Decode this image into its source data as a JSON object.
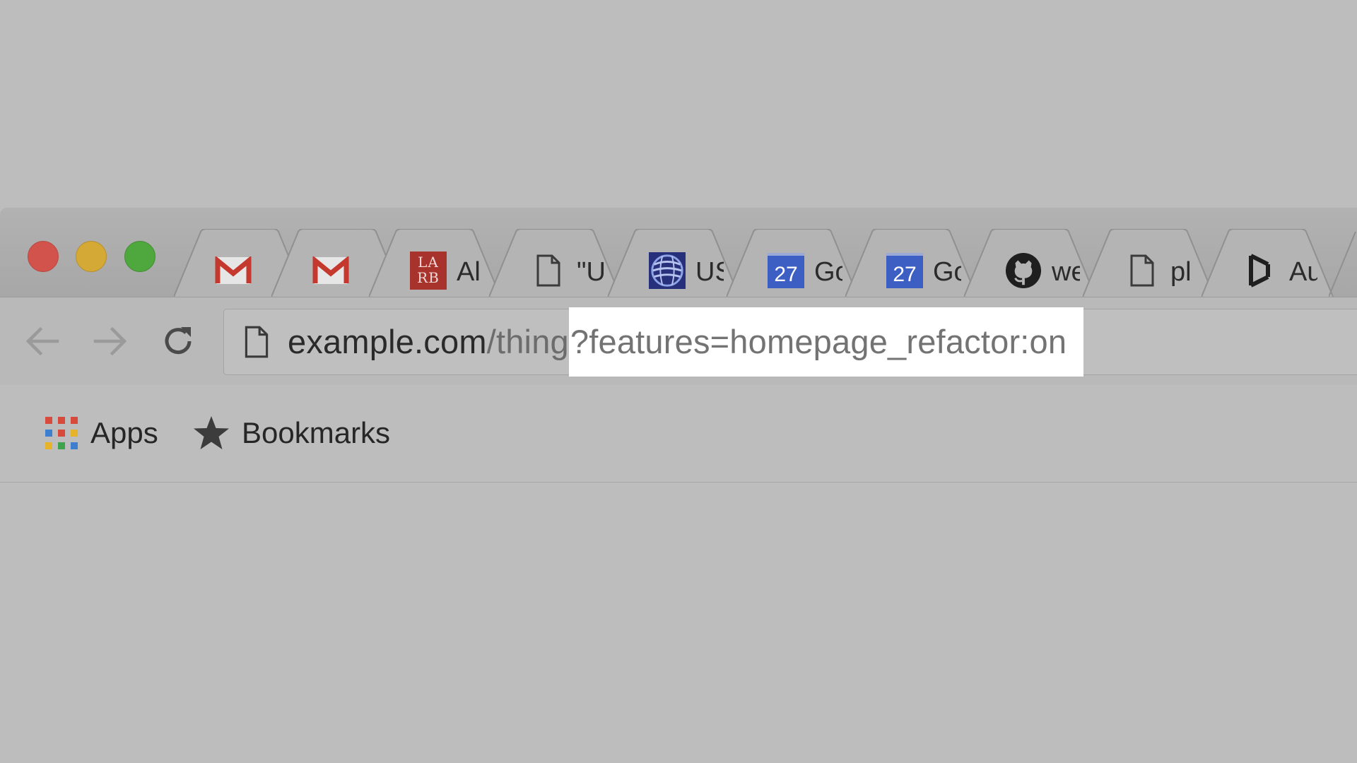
{
  "window": {
    "controls": [
      "close",
      "minimize",
      "zoom"
    ]
  },
  "tabs": [
    {
      "favicon": "gmail-icon",
      "title": ""
    },
    {
      "favicon": "gmail-icon",
      "title": ""
    },
    {
      "favicon": "larb-icon",
      "title": "Al"
    },
    {
      "favicon": "document-icon",
      "title": "\"U"
    },
    {
      "favicon": "globe-logo-icon",
      "title": "US"
    },
    {
      "favicon": "calendar-icon",
      "title": "Go"
    },
    {
      "favicon": "calendar-icon",
      "title": "Go"
    },
    {
      "favicon": "github-icon",
      "title": "we"
    },
    {
      "favicon": "document-icon",
      "title": "pl"
    },
    {
      "favicon": "arrow-logo-icon",
      "title": "Au"
    }
  ],
  "larb_text": "LA RB",
  "calendar_day": "27",
  "toolbar": {
    "back": "back-arrow-icon",
    "forward": "forward-arrow-icon",
    "reload": "reload-icon"
  },
  "omnibox": {
    "host": "example.com",
    "path": "/thing",
    "query": "?features=homepage_refactor:on"
  },
  "bookmarks": {
    "apps_label": "Apps",
    "bookmarks_label": "Bookmarks"
  },
  "colors": {
    "gmail_red": "#c5382e",
    "calendar_blue": "#3d5fc4",
    "larb_red": "#a8332d",
    "highlight": "#ffffff"
  }
}
